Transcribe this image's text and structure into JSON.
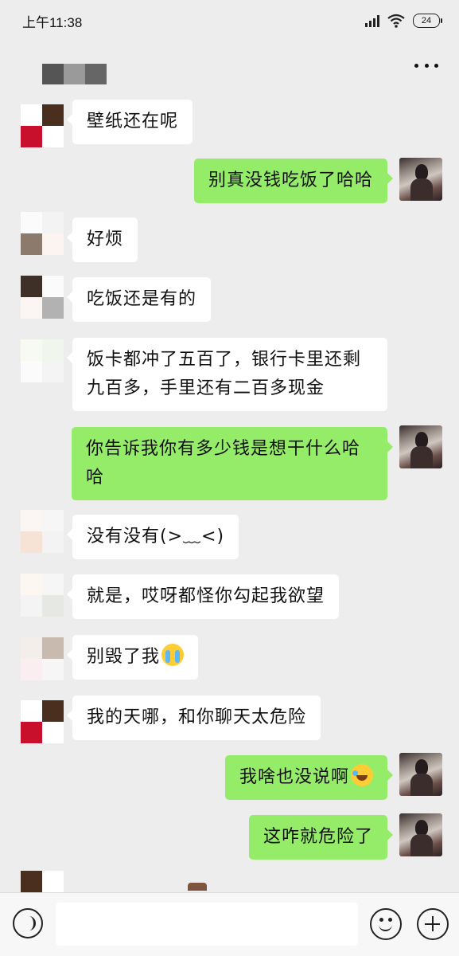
{
  "status_bar": {
    "time": "上午11:38",
    "battery": "24",
    "icons": [
      "signal-icon",
      "wifi-icon",
      "battery-icon"
    ]
  },
  "header": {
    "contact_name": "",
    "more_icon": "more-dots-icon"
  },
  "messages": [
    {
      "side": "in",
      "text": "壁纸还在呢"
    },
    {
      "side": "out",
      "text": "别真没钱吃饭了哈哈"
    },
    {
      "side": "in",
      "text": "好烦"
    },
    {
      "side": "in",
      "text": "吃饭还是有的"
    },
    {
      "side": "in",
      "text": "饭卡都冲了五百了，银行卡里还剩九百多，手里还有二百多现金"
    },
    {
      "side": "out",
      "text": "你告诉我你有多少钱是想干什么哈哈"
    },
    {
      "side": "in",
      "text": "没有没有(>﹏<)"
    },
    {
      "side": "in",
      "text": "就是，哎呀都怪你勾起我欲望"
    },
    {
      "side": "in",
      "text": "别毁了我",
      "emoji": "loudly-crying-face-icon"
    },
    {
      "side": "in",
      "text": "我的天哪，和你聊天太危险"
    },
    {
      "side": "out",
      "text": "我啥也没说啊",
      "emoji": "rolling-laughing-face-icon"
    },
    {
      "side": "out",
      "text": "这咋就危险了"
    }
  ],
  "input_bar": {
    "voice_icon": "voice-icon",
    "input_value": "",
    "emoji_icon": "smiley-icon",
    "plus_icon": "plus-icon"
  },
  "colors": {
    "background": "#ededed",
    "incoming_bubble": "#ffffff",
    "outgoing_bubble": "#95ec69"
  }
}
